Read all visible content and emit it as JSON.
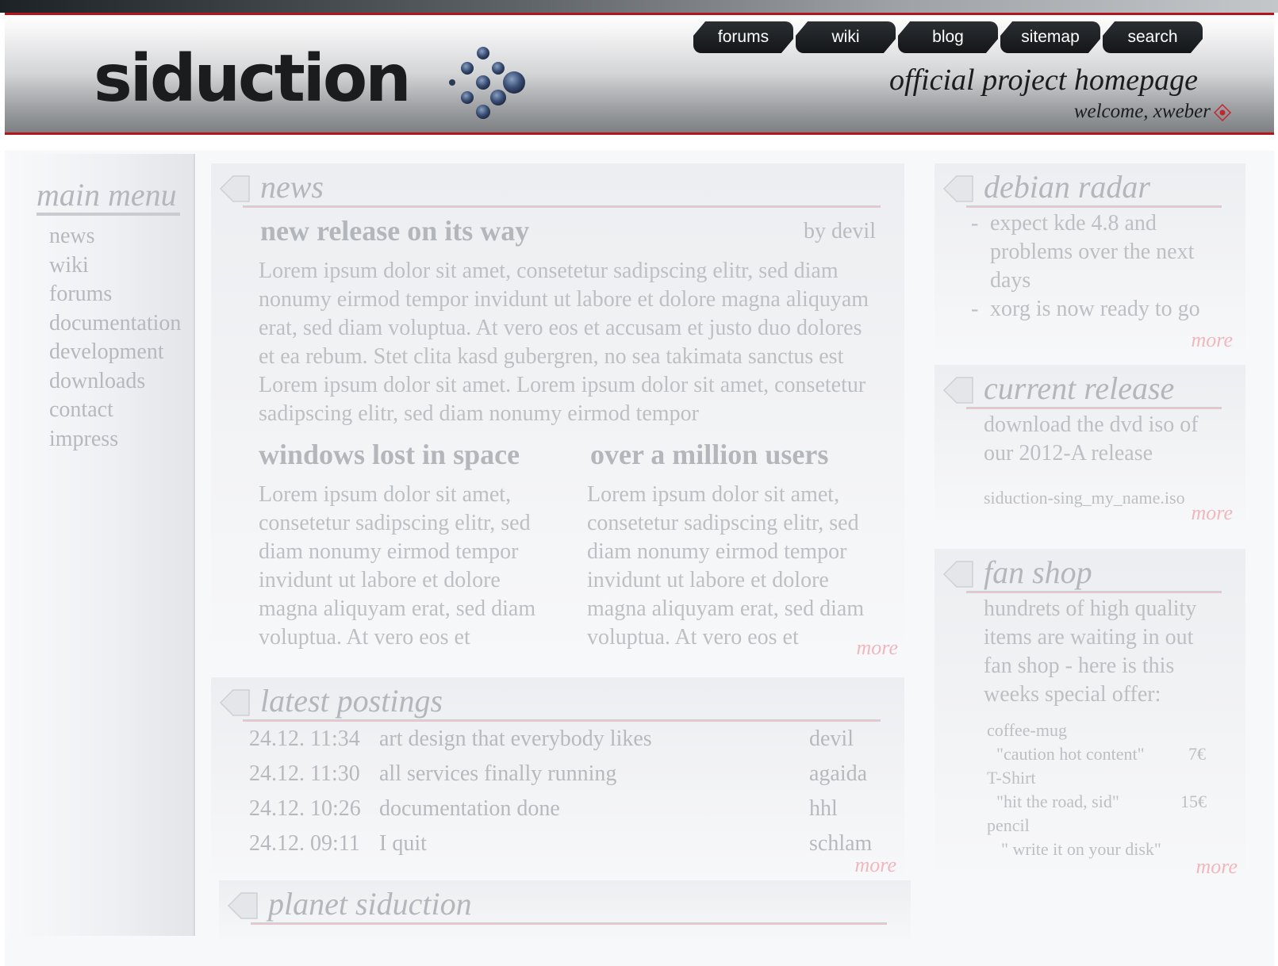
{
  "header": {
    "logo_text": "siduction",
    "tagline": "official project homepage",
    "welcome": "welcome, xweber",
    "nav": [
      "forums",
      "wiki",
      "blog",
      "sitemap",
      "search"
    ],
    "logout_icon": "logout-icon"
  },
  "sidebar": {
    "title": "main menu",
    "items": [
      "news",
      "wiki",
      "forums",
      "documentation",
      "development",
      "downloads",
      "contact",
      "impress"
    ]
  },
  "news": {
    "title": "news",
    "lead": {
      "title": "new release on its way",
      "author": "by devil",
      "body": "Lorem ipsum dolor sit amet, consetetur sadipscing elitr, sed diam nonumy eirmod tempor invidunt ut labore et dolore magna aliquyam erat, sed diam voluptua. At vero eos et accusam et justo duo dolores et ea rebum. Stet clita kasd gubergren, no sea takimata sanctus est Lorem ipsum dolor sit amet. Lorem ipsum dolor sit amet, consetetur sadipscing elitr, sed diam nonumy eirmod tempor"
    },
    "col1": {
      "title": "windows lost in space",
      "body": "Lorem ipsum dolor sit amet, consetetur sadipscing elitr, sed diam nonumy eirmod tempor invidunt ut labore et dolore magna aliquyam erat, sed diam voluptua. At vero eos et"
    },
    "col2": {
      "title": "over a million users",
      "body": "Lorem ipsum dolor sit amet, consetetur sadipscing elitr, sed diam nonumy eirmod tempor invidunt ut labore et dolore magna aliquyam erat, sed diam voluptua. At vero eos et"
    },
    "more": "more"
  },
  "postings": {
    "title": "latest postings",
    "rows": [
      {
        "time": "24.12. 11:34",
        "subject": "art design that everybody likes",
        "author": "devil"
      },
      {
        "time": "24.12. 11:30",
        "subject": "all services finally running",
        "author": "agaida"
      },
      {
        "time": "24.12. 10:26",
        "subject": "documentation done",
        "author": "hhl"
      },
      {
        "time": "24.12. 09:11",
        "subject": "I quit",
        "author": "schlam"
      }
    ],
    "more": "more"
  },
  "planet": {
    "title": "planet siduction"
  },
  "radar": {
    "title": "debian radar",
    "items": [
      "expect kde 4.8 and problems over the next days",
      "xorg is now ready to go"
    ],
    "more": "more"
  },
  "release": {
    "title": "current release",
    "text": "download the dvd iso of our 2012-A release",
    "file": "siduction-sing_my_name.iso",
    "more": "more"
  },
  "shop": {
    "title": "fan shop",
    "text": "hundrets of high quality items are waiting in out fan shop - here is this weeks special offer:",
    "items": [
      {
        "name": "coffee-mug",
        "detail": "\"caution hot content\"",
        "price": "7€"
      },
      {
        "name": "T-Shirt",
        "detail": "\"hit the road, sid\"",
        "price": "15€"
      },
      {
        "name": "pencil",
        "detail": "\" write it on your disk\"",
        "price": ""
      }
    ],
    "more": "more"
  },
  "colors": {
    "accent_red": "#b3151b",
    "more_link": "#f0b7bd",
    "nav_bg": "#1b1e21"
  }
}
